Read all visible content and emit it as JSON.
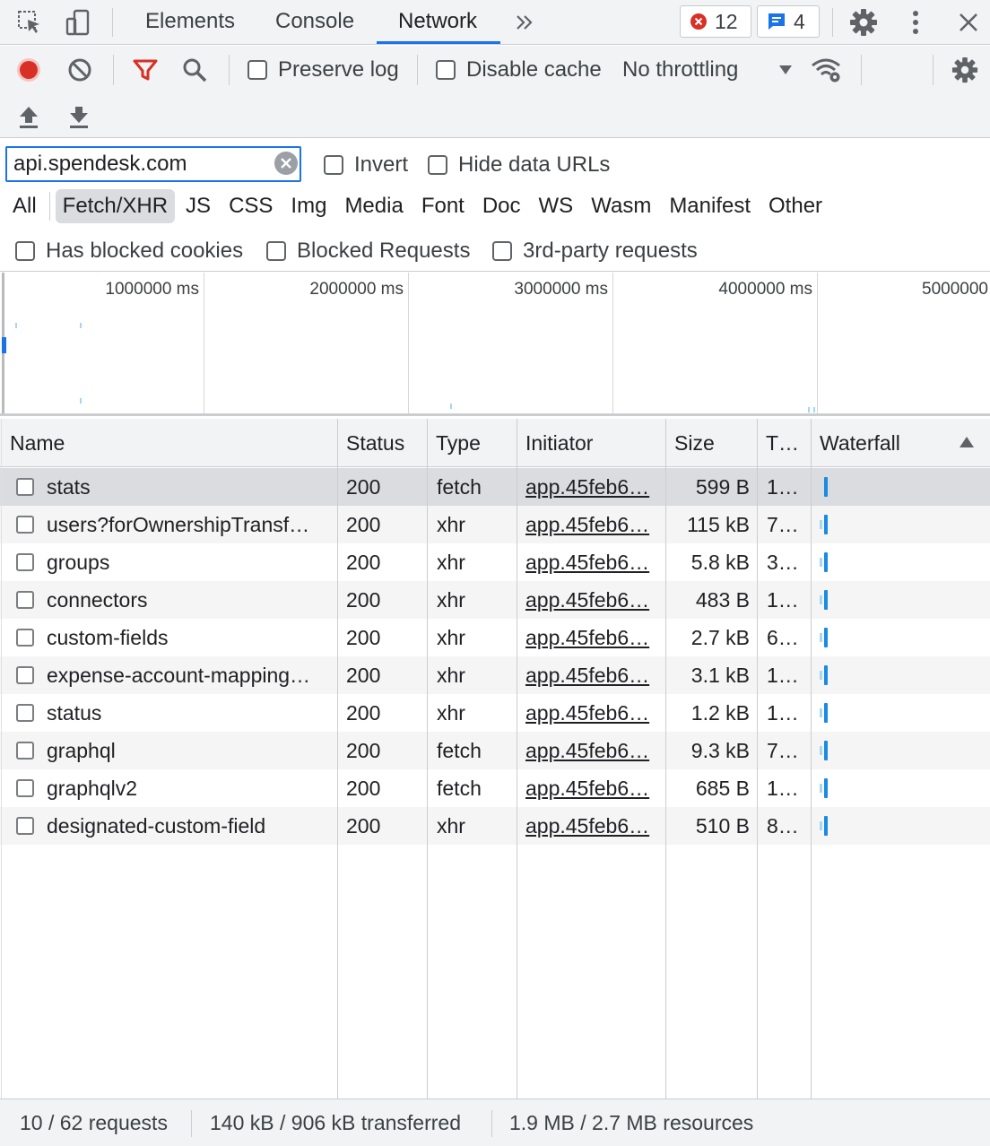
{
  "tabs": {
    "items": [
      {
        "label": "Elements"
      },
      {
        "label": "Console"
      },
      {
        "label": "Network"
      }
    ],
    "more_icon": "chevron-double-right-icon",
    "errors_count": "12",
    "messages_count": "4"
  },
  "toolbar": {
    "preserve_log": "Preserve log",
    "disable_cache": "Disable cache",
    "throttling": "No throttling"
  },
  "filter": {
    "value": "api.spendesk.com",
    "invert": "Invert",
    "hide_data_urls": "Hide data URLs",
    "types": [
      "All",
      "Fetch/XHR",
      "JS",
      "CSS",
      "Img",
      "Media",
      "Font",
      "Doc",
      "WS",
      "Wasm",
      "Manifest",
      "Other"
    ],
    "active_type": "Fetch/XHR",
    "has_blocked_cookies": "Has blocked cookies",
    "blocked_requests": "Blocked Requests",
    "third_party": "3rd-party requests"
  },
  "overview": {
    "ticks": [
      "1000000 ms",
      "2000000 ms",
      "3000000 ms",
      "4000000 ms",
      "5000000"
    ]
  },
  "table": {
    "headers": {
      "name": "Name",
      "status": "Status",
      "type": "Type",
      "initiator": "Initiator",
      "size": "Size",
      "time": "T…",
      "waterfall": "Waterfall"
    },
    "rows": [
      {
        "name": "stats",
        "status": "200",
        "type": "fetch",
        "initiator": "app.45feb6…",
        "size": "599 B",
        "time": "1…"
      },
      {
        "name": "users?forOwnershipTransf…",
        "status": "200",
        "type": "xhr",
        "initiator": "app.45feb6…",
        "size": "115 kB",
        "time": "7…"
      },
      {
        "name": "groups",
        "status": "200",
        "type": "xhr",
        "initiator": "app.45feb6…",
        "size": "5.8 kB",
        "time": "3…"
      },
      {
        "name": "connectors",
        "status": "200",
        "type": "xhr",
        "initiator": "app.45feb6…",
        "size": "483 B",
        "time": "1…"
      },
      {
        "name": "custom-fields",
        "status": "200",
        "type": "xhr",
        "initiator": "app.45feb6…",
        "size": "2.7 kB",
        "time": "6…"
      },
      {
        "name": "expense-account-mapping…",
        "status": "200",
        "type": "xhr",
        "initiator": "app.45feb6…",
        "size": "3.1 kB",
        "time": "1…"
      },
      {
        "name": "status",
        "status": "200",
        "type": "xhr",
        "initiator": "app.45feb6…",
        "size": "1.2 kB",
        "time": "1…"
      },
      {
        "name": "graphql",
        "status": "200",
        "type": "fetch",
        "initiator": "app.45feb6…",
        "size": "9.3 kB",
        "time": "7…"
      },
      {
        "name": "graphqlv2",
        "status": "200",
        "type": "fetch",
        "initiator": "app.45feb6…",
        "size": "685 B",
        "time": "1…"
      },
      {
        "name": "designated-custom-field",
        "status": "200",
        "type": "xhr",
        "initiator": "app.45feb6…",
        "size": "510 B",
        "time": "8…"
      }
    ]
  },
  "status": {
    "requests": "10 / 62 requests",
    "transferred": "140 kB / 906 kB transferred",
    "resources": "1.9 MB / 2.7 MB resources"
  }
}
